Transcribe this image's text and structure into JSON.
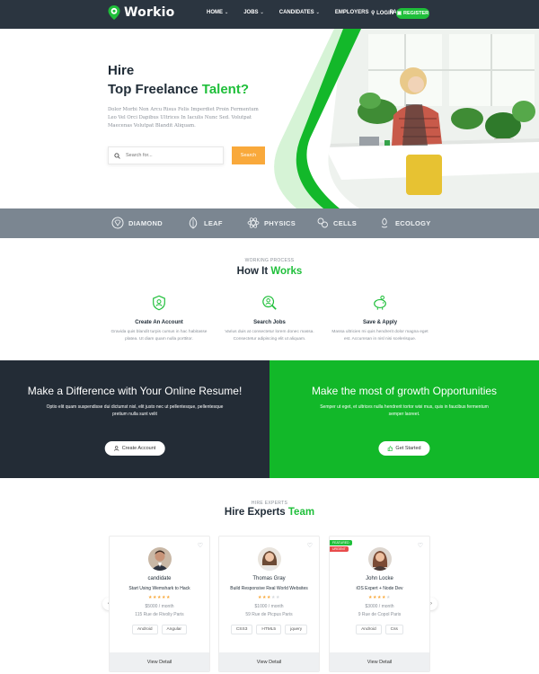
{
  "nav": {
    "brand": "Workio",
    "menu": [
      {
        "label": "HOME"
      },
      {
        "label": "JOBS"
      },
      {
        "label": "CANDIDATES"
      },
      {
        "label": "EMPLOYERS"
      },
      {
        "label": "PAGES"
      }
    ],
    "login": "LOGIN",
    "register": "REGISTER"
  },
  "hero": {
    "title_line1": "Hire",
    "title_line2_plain": "Top Freelance ",
    "title_line2_accent": "Talent?",
    "description": "Dolor Morbi Non Arcu Risus Felis Imperdiet Proin Fermentum Leo Vel Orci Dapibus Ultrices In Iaculis Nunc Sed. Volutpat Maecenas Volutpat Blandit Aliquam.",
    "search_placeholder": "Search for...",
    "search_button": "Search"
  },
  "brands": [
    "DIAMOND",
    "LEAF",
    "PHYSICS",
    "CELLS",
    "ECOLOGY"
  ],
  "how": {
    "eyebrow": "WORKING PROCESS",
    "title_plain": "How It ",
    "title_accent": "Works",
    "steps": [
      {
        "icon": "shield-user-icon",
        "title": "Create An Account",
        "desc": "Gravida quis blandit turpis cursus in hac habitasse platea. Ut diam quam nulla porttitor."
      },
      {
        "icon": "search-user-icon",
        "title": "Search Jobs",
        "desc": "Varius duis at consectetur lorem donec massa. Consectetur adipiscing elit ut aliquam."
      },
      {
        "icon": "piggy-bank-icon",
        "title": "Save & Apply",
        "desc": "Massa ultricies mi quis hendrerit dolor magna eget est. Accumsan in nisl nisi scelerisque."
      }
    ]
  },
  "cta": {
    "left": {
      "title": "Make a Difference with Your Online Resume!",
      "text": "Optio elit quam suspendisse dui dictumst nisl, elit justo nec ut pellentesque, pellentesque pretium nulla sunt velit",
      "button": "Create Account"
    },
    "right": {
      "title": "Make the most of growth Opportunities",
      "text": "Semper ut eget, et ultrices nulla hendrerit tortor wisi mus, quis in faucibus fermentum semper laoreet.",
      "button": "Get Started"
    }
  },
  "experts": {
    "eyebrow": "HIRE EXPERTS",
    "title_plain": "Hire Experts ",
    "title_accent": "Team",
    "cards": [
      {
        "name": "candidate",
        "role": "Start Using Wemshark to Hack",
        "rating": 5,
        "rate": "$5000 / month",
        "address": "115 Rue de Rivoliy Paris",
        "tags": [
          "Android",
          "Angular"
        ],
        "view": "View Detail"
      },
      {
        "name": "Thomas Gray",
        "role": "Build Responsive Real World Websites",
        "rating": 3,
        "rate": "$1000 / month",
        "address": "59 Rue de Picpus Paris",
        "tags": [
          "CSS3",
          "HTML5",
          "jquery"
        ],
        "view": "View Detail"
      },
      {
        "name": "John Locke",
        "role": "iOS Expert + Node Dev",
        "rating": 4,
        "rate": "$3000 / month",
        "address": "9 Rue de Copol Paris",
        "tags": [
          "Android",
          "Css"
        ],
        "view": "View Detail",
        "badges": [
          "FEATURED",
          "URGENT"
        ]
      }
    ]
  },
  "colors": {
    "accent": "#1fbf3a",
    "nav_bg": "#2b3540",
    "strip_bg": "#7b8691",
    "cta_dark": "#232c36",
    "cta_green": "#12b829",
    "search_btn": "#f9a93b"
  }
}
